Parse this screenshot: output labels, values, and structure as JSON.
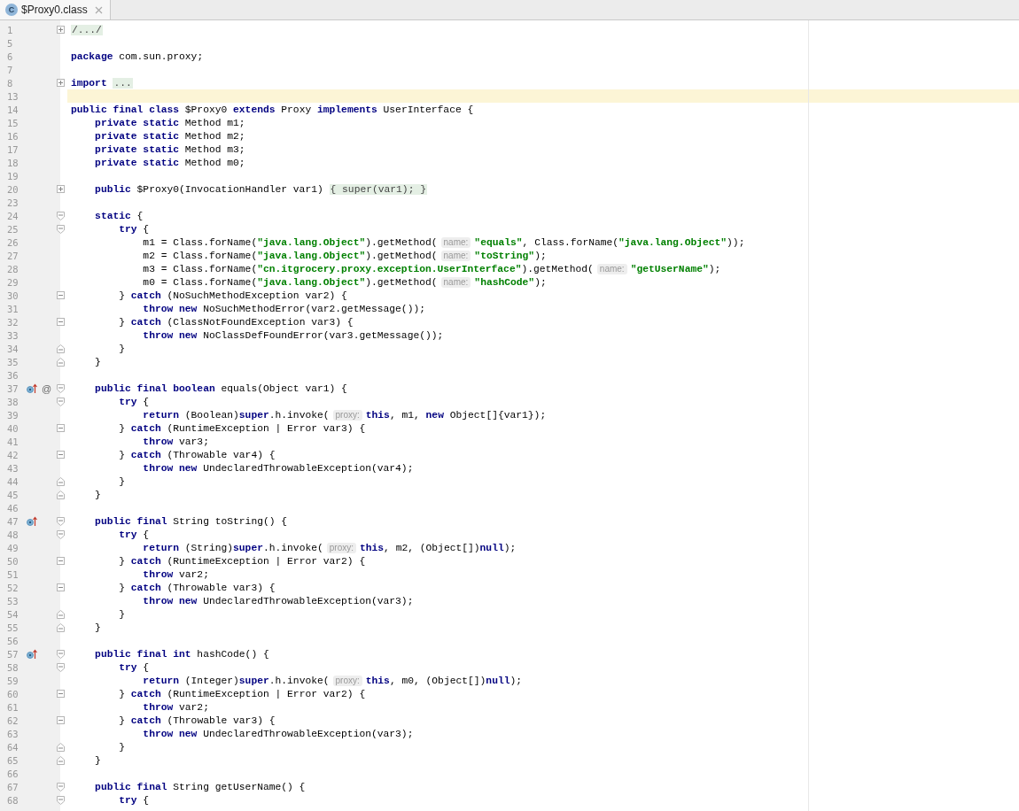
{
  "tabs": [
    {
      "title": "$Proxy0.class",
      "icon_letter": "C",
      "selected": true
    }
  ],
  "lines": [
    {
      "number": "1",
      "kind": "collapsed",
      "current": false,
      "tokens": [
        {
          "kind": "folded",
          "text": "/.../"
        }
      ]
    },
    {
      "number": "5",
      "kind": "plain",
      "current": false
    },
    {
      "number": "6",
      "kind": "plain",
      "current": false,
      "tokens": [
        {
          "kind": "keyword",
          "text": "package"
        },
        {
          "kind": "plain",
          "text": " com.sun.proxy;"
        }
      ]
    },
    {
      "number": "7",
      "kind": "plain",
      "current": false
    },
    {
      "number": "8",
      "kind": "collapsed",
      "current": false,
      "tokens": [
        {
          "kind": "keyword",
          "text": "import"
        },
        {
          "kind": "folded",
          "text": "..."
        }
      ]
    },
    {
      "number": "13",
      "kind": "plain",
      "current": true
    },
    {
      "number": "14",
      "kind": "plain",
      "current": false,
      "tokens": [
        {
          "kind": "keyword",
          "text": "public final class"
        },
        {
          "kind": "plain",
          "text": " $Proxy0 "
        },
        {
          "kind": "keyword",
          "text": "extends"
        },
        {
          "kind": "plain",
          "text": " Proxy "
        },
        {
          "kind": "keyword",
          "text": "implements"
        },
        {
          "kind": "plain",
          "text": " UserInterface {"
        }
      ]
    },
    {
      "number": "15",
      "kind": "plain",
      "current": false,
      "tokens": [
        {
          "kind": "keyword",
          "text": "    private static"
        },
        {
          "kind": "plain",
          "text": " Method m1;"
        }
      ]
    },
    {
      "number": "16",
      "kind": "plain",
      "current": false,
      "tokens": [
        {
          "kind": "keyword",
          "text": "    private static"
        },
        {
          "kind": "plain",
          "text": " Method m2;"
        }
      ]
    },
    {
      "number": "17",
      "kind": "plain",
      "current": false,
      "tokens": [
        {
          "kind": "keyword",
          "text": "    private static"
        },
        {
          "kind": "plain",
          "text": " Method m3;"
        }
      ]
    },
    {
      "number": "18",
      "kind": "plain",
      "current": false,
      "tokens": [
        {
          "kind": "keyword",
          "text": "    private static"
        },
        {
          "kind": "plain",
          "text": " Method m0;"
        }
      ]
    },
    {
      "number": "19",
      "kind": "plain",
      "current": false
    },
    {
      "number": "20",
      "kind": "collapsed",
      "current": false,
      "tokens": [
        {
          "kind": "keyword",
          "text": "    public"
        },
        {
          "kind": "plain",
          "text": " $Proxy0(InvocationHandler var1) "
        },
        {
          "kind": "folded",
          "text": "{ super(var1); }"
        }
      ]
    },
    {
      "number": "23",
      "kind": "plain",
      "current": false
    },
    {
      "number": "24",
      "kind": "start",
      "current": false,
      "tokens": [
        {
          "kind": "keyword",
          "text": "    static"
        },
        {
          "kind": "plain",
          "text": " {"
        }
      ]
    },
    {
      "number": "25",
      "kind": "start",
      "current": false,
      "tokens": [
        {
          "kind": "keyword",
          "text": "        try"
        },
        {
          "kind": "plain",
          "text": " {"
        }
      ]
    },
    {
      "number": "26",
      "kind": "plain",
      "current": false,
      "tokens": [
        {
          "kind": "plain",
          "text": "            m1 = Class.forName("
        },
        {
          "kind": "string",
          "text": "\"java.lang.Object\""
        },
        {
          "kind": "plain",
          "text": ").getMethod("
        },
        {
          "kind": "hint",
          "text": "name:"
        },
        {
          "kind": "string",
          "text": "\"equals\""
        },
        {
          "kind": "plain",
          "text": ", Class.forName("
        },
        {
          "kind": "string",
          "text": "\"java.lang.Object\""
        },
        {
          "kind": "plain",
          "text": "));"
        }
      ]
    },
    {
      "number": "27",
      "kind": "plain",
      "current": false,
      "tokens": [
        {
          "kind": "plain",
          "text": "            m2 = Class.forName("
        },
        {
          "kind": "string",
          "text": "\"java.lang.Object\""
        },
        {
          "kind": "plain",
          "text": ").getMethod("
        },
        {
          "kind": "hint",
          "text": "name:"
        },
        {
          "kind": "string",
          "text": "\"toString\""
        },
        {
          "kind": "plain",
          "text": ");"
        }
      ]
    },
    {
      "number": "28",
      "kind": "plain",
      "current": false,
      "tokens": [
        {
          "kind": "plain",
          "text": "            m3 = Class.forName("
        },
        {
          "kind": "string",
          "text": "\"cn.itgrocery.proxy.exception.UserInterface\""
        },
        {
          "kind": "plain",
          "text": ").getMethod("
        },
        {
          "kind": "hint",
          "text": "name:"
        },
        {
          "kind": "string",
          "text": "\"getUserName\""
        },
        {
          "kind": "plain",
          "text": ");"
        }
      ]
    },
    {
      "number": "29",
      "kind": "plain",
      "current": false,
      "tokens": [
        {
          "kind": "plain",
          "text": "            m0 = Class.forName("
        },
        {
          "kind": "string",
          "text": "\"java.lang.Object\""
        },
        {
          "kind": "plain",
          "text": ").getMethod("
        },
        {
          "kind": "hint",
          "text": "name:"
        },
        {
          "kind": "string",
          "text": "\"hashCode\""
        },
        {
          "kind": "plain",
          "text": ");"
        }
      ]
    },
    {
      "number": "30",
      "kind": "mid",
      "current": false,
      "tokens": [
        {
          "kind": "plain",
          "text": "        } "
        },
        {
          "kind": "keyword",
          "text": "catch"
        },
        {
          "kind": "plain",
          "text": " (NoSuchMethodException var2) {"
        }
      ]
    },
    {
      "number": "31",
      "kind": "plain",
      "current": false,
      "tokens": [
        {
          "kind": "keyword",
          "text": "            throw new"
        },
        {
          "kind": "plain",
          "text": " NoSuchMethodError(var2.getMessage());"
        }
      ]
    },
    {
      "number": "32",
      "kind": "mid",
      "current": false,
      "tokens": [
        {
          "kind": "plain",
          "text": "        } "
        },
        {
          "kind": "keyword",
          "text": "catch"
        },
        {
          "kind": "plain",
          "text": " (ClassNotFoundException var3) {"
        }
      ]
    },
    {
      "number": "33",
      "kind": "plain",
      "current": false,
      "tokens": [
        {
          "kind": "keyword",
          "text": "            throw new"
        },
        {
          "kind": "plain",
          "text": " NoClassDefFoundError(var3.getMessage());"
        }
      ]
    },
    {
      "number": "34",
      "kind": "end",
      "current": false,
      "tokens": [
        {
          "kind": "plain",
          "text": "        }"
        }
      ]
    },
    {
      "number": "35",
      "kind": "end",
      "current": false,
      "tokens": [
        {
          "kind": "plain",
          "text": "    }"
        }
      ]
    },
    {
      "number": "36",
      "kind": "plain",
      "current": false
    },
    {
      "number": "37",
      "kind": "start",
      "current": false,
      "gutter_icons": [
        {
          "kind": "override"
        }
      ],
      "gutter_text": "@",
      "tokens": [
        {
          "kind": "keyword",
          "text": "    public final boolean"
        },
        {
          "kind": "plain",
          "text": " equals(Object var1) {"
        }
      ]
    },
    {
      "number": "38",
      "kind": "start",
      "current": false,
      "tokens": [
        {
          "kind": "keyword",
          "text": "        try"
        },
        {
          "kind": "plain",
          "text": " {"
        }
      ]
    },
    {
      "number": "39",
      "kind": "plain",
      "current": false,
      "tokens": [
        {
          "kind": "keyword",
          "text": "            return"
        },
        {
          "kind": "plain",
          "text": " (Boolean)"
        },
        {
          "kind": "keyword",
          "text": "super"
        },
        {
          "kind": "plain",
          "text": ".h.invoke("
        },
        {
          "kind": "hint",
          "text": "proxy:"
        },
        {
          "kind": "keyword",
          "text": "this"
        },
        {
          "kind": "plain",
          "text": ", m1, "
        },
        {
          "kind": "keyword",
          "text": "new"
        },
        {
          "kind": "plain",
          "text": " Object[]{var1});"
        }
      ]
    },
    {
      "number": "40",
      "kind": "mid",
      "current": false,
      "tokens": [
        {
          "kind": "plain",
          "text": "        } "
        },
        {
          "kind": "keyword",
          "text": "catch"
        },
        {
          "kind": "plain",
          "text": " (RuntimeException | Error var3) {"
        }
      ]
    },
    {
      "number": "41",
      "kind": "plain",
      "current": false,
      "tokens": [
        {
          "kind": "keyword",
          "text": "            throw"
        },
        {
          "kind": "plain",
          "text": " var3;"
        }
      ]
    },
    {
      "number": "42",
      "kind": "mid",
      "current": false,
      "tokens": [
        {
          "kind": "plain",
          "text": "        } "
        },
        {
          "kind": "keyword",
          "text": "catch"
        },
        {
          "kind": "plain",
          "text": " (Throwable var4) {"
        }
      ]
    },
    {
      "number": "43",
      "kind": "plain",
      "current": false,
      "tokens": [
        {
          "kind": "keyword",
          "text": "            throw new"
        },
        {
          "kind": "plain",
          "text": " UndeclaredThrowableException(var4);"
        }
      ]
    },
    {
      "number": "44",
      "kind": "end",
      "current": false,
      "tokens": [
        {
          "kind": "plain",
          "text": "        }"
        }
      ]
    },
    {
      "number": "45",
      "kind": "end",
      "current": false,
      "tokens": [
        {
          "kind": "plain",
          "text": "    }"
        }
      ]
    },
    {
      "number": "46",
      "kind": "plain",
      "current": false
    },
    {
      "number": "47",
      "kind": "start",
      "current": false,
      "gutter_icons": [
        {
          "kind": "override"
        }
      ],
      "tokens": [
        {
          "kind": "keyword",
          "text": "    public final"
        },
        {
          "kind": "plain",
          "text": " String toString() {"
        }
      ]
    },
    {
      "number": "48",
      "kind": "start",
      "current": false,
      "tokens": [
        {
          "kind": "keyword",
          "text": "        try"
        },
        {
          "kind": "plain",
          "text": " {"
        }
      ]
    },
    {
      "number": "49",
      "kind": "plain",
      "current": false,
      "tokens": [
        {
          "kind": "keyword",
          "text": "            return"
        },
        {
          "kind": "plain",
          "text": " (String)"
        },
        {
          "kind": "keyword",
          "text": "super"
        },
        {
          "kind": "plain",
          "text": ".h.invoke("
        },
        {
          "kind": "hint",
          "text": "proxy:"
        },
        {
          "kind": "keyword",
          "text": "this"
        },
        {
          "kind": "plain",
          "text": ", m2, (Object[])"
        },
        {
          "kind": "keyword",
          "text": "null"
        },
        {
          "kind": "plain",
          "text": ");"
        }
      ]
    },
    {
      "number": "50",
      "kind": "mid",
      "current": false,
      "tokens": [
        {
          "kind": "plain",
          "text": "        } "
        },
        {
          "kind": "keyword",
          "text": "catch"
        },
        {
          "kind": "plain",
          "text": " (RuntimeException | Error var2) {"
        }
      ]
    },
    {
      "number": "51",
      "kind": "plain",
      "current": false,
      "tokens": [
        {
          "kind": "keyword",
          "text": "            throw"
        },
        {
          "kind": "plain",
          "text": " var2;"
        }
      ]
    },
    {
      "number": "52",
      "kind": "mid",
      "current": false,
      "tokens": [
        {
          "kind": "plain",
          "text": "        } "
        },
        {
          "kind": "keyword",
          "text": "catch"
        },
        {
          "kind": "plain",
          "text": " (Throwable var3) {"
        }
      ]
    },
    {
      "number": "53",
      "kind": "plain",
      "current": false,
      "tokens": [
        {
          "kind": "keyword",
          "text": "            throw new"
        },
        {
          "kind": "plain",
          "text": " UndeclaredThrowableException(var3);"
        }
      ]
    },
    {
      "number": "54",
      "kind": "end",
      "current": false,
      "tokens": [
        {
          "kind": "plain",
          "text": "        }"
        }
      ]
    },
    {
      "number": "55",
      "kind": "end",
      "current": false,
      "tokens": [
        {
          "kind": "plain",
          "text": "    }"
        }
      ]
    },
    {
      "number": "56",
      "kind": "plain",
      "current": false
    },
    {
      "number": "57",
      "kind": "start",
      "current": false,
      "gutter_icons": [
        {
          "kind": "override"
        }
      ],
      "tokens": [
        {
          "kind": "keyword",
          "text": "    public final int"
        },
        {
          "kind": "plain",
          "text": " hashCode() {"
        }
      ]
    },
    {
      "number": "58",
      "kind": "start",
      "current": false,
      "tokens": [
        {
          "kind": "keyword",
          "text": "        try"
        },
        {
          "kind": "plain",
          "text": " {"
        }
      ]
    },
    {
      "number": "59",
      "kind": "plain",
      "current": false,
      "tokens": [
        {
          "kind": "keyword",
          "text": "            return"
        },
        {
          "kind": "plain",
          "text": " (Integer)"
        },
        {
          "kind": "keyword",
          "text": "super"
        },
        {
          "kind": "plain",
          "text": ".h.invoke("
        },
        {
          "kind": "hint",
          "text": "proxy:"
        },
        {
          "kind": "keyword",
          "text": "this"
        },
        {
          "kind": "plain",
          "text": ", m0, (Object[])"
        },
        {
          "kind": "keyword",
          "text": "null"
        },
        {
          "kind": "plain",
          "text": ");"
        }
      ]
    },
    {
      "number": "60",
      "kind": "mid",
      "current": false,
      "tokens": [
        {
          "kind": "plain",
          "text": "        } "
        },
        {
          "kind": "keyword",
          "text": "catch"
        },
        {
          "kind": "plain",
          "text": " (RuntimeException | Error var2) {"
        }
      ]
    },
    {
      "number": "61",
      "kind": "plain",
      "current": false,
      "tokens": [
        {
          "kind": "keyword",
          "text": "            throw"
        },
        {
          "kind": "plain",
          "text": " var2;"
        }
      ]
    },
    {
      "number": "62",
      "kind": "mid",
      "current": false,
      "tokens": [
        {
          "kind": "plain",
          "text": "        } "
        },
        {
          "kind": "keyword",
          "text": "catch"
        },
        {
          "kind": "plain",
          "text": " (Throwable var3) {"
        }
      ]
    },
    {
      "number": "63",
      "kind": "plain",
      "current": false,
      "tokens": [
        {
          "kind": "keyword",
          "text": "            throw new"
        },
        {
          "kind": "plain",
          "text": " UndeclaredThrowableException(var3);"
        }
      ]
    },
    {
      "number": "64",
      "kind": "end",
      "current": false,
      "tokens": [
        {
          "kind": "plain",
          "text": "        }"
        }
      ]
    },
    {
      "number": "65",
      "kind": "end",
      "current": false,
      "tokens": [
        {
          "kind": "plain",
          "text": "    }"
        }
      ]
    },
    {
      "number": "66",
      "kind": "plain",
      "current": false
    },
    {
      "number": "67",
      "kind": "start",
      "current": false,
      "tokens": [
        {
          "kind": "keyword",
          "text": "    public final"
        },
        {
          "kind": "plain",
          "text": " String getUserName() {"
        }
      ]
    },
    {
      "number": "68",
      "kind": "start",
      "current": false,
      "tokens": [
        {
          "kind": "keyword",
          "text": "        try"
        },
        {
          "kind": "plain",
          "text": " {"
        }
      ]
    }
  ]
}
